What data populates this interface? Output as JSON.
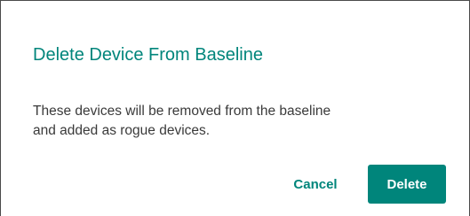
{
  "dialog": {
    "title": "Delete Device From Baseline",
    "message_lines": [
      "These devices will be removed from the baseline",
      "and added as rogue devices."
    ],
    "cancel_label": "Cancel",
    "delete_label": "Delete"
  },
  "colors": {
    "accent": "#00857b",
    "text": "#3a3a3a",
    "background": "#ffffff",
    "border": "#4a4a4a"
  }
}
